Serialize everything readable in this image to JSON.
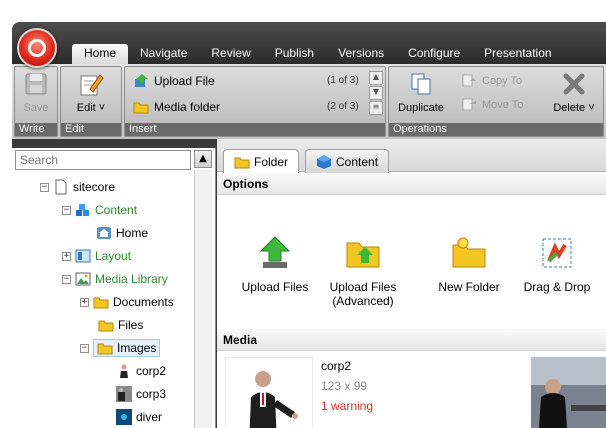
{
  "ribbon_tabs": [
    "Home",
    "Navigate",
    "Review",
    "Publish",
    "Versions",
    "Configure",
    "Presentation"
  ],
  "groups": {
    "write": {
      "label": "Write",
      "save": "Save"
    },
    "edit": {
      "label": "Edit",
      "edit": "Edit ˅"
    },
    "insert": {
      "label": "Insert",
      "items": [
        {
          "label": "Upload File",
          "count": "(1 of 3)"
        },
        {
          "label": "Media folder",
          "count": "(2 of 3)"
        }
      ]
    },
    "operations": {
      "label": "Operations",
      "duplicate": "Duplicate",
      "copy_to": "Copy To",
      "move_to": "Move To",
      "delete": "Delete ˅"
    }
  },
  "search": {
    "placeholder": "Search"
  },
  "tree": [
    {
      "label": "sitecore"
    },
    {
      "label": "Content"
    },
    {
      "label": "Home"
    },
    {
      "label": "Layout"
    },
    {
      "label": "Media Library"
    },
    {
      "label": "Documents"
    },
    {
      "label": "Files"
    },
    {
      "label": "Images"
    },
    {
      "label": "corp2"
    },
    {
      "label": "corp3"
    },
    {
      "label": "diver"
    }
  ],
  "content_tabs": [
    "Folder",
    "Content"
  ],
  "sections": {
    "options": "Options",
    "media": "Media"
  },
  "options": [
    {
      "label": "Upload Files",
      "sub": ""
    },
    {
      "label": "Upload Files",
      "sub": "(Advanced)"
    },
    {
      "label": "New Folder",
      "sub": ""
    },
    {
      "label": "Drag & Drop",
      "sub": ""
    }
  ],
  "media": [
    {
      "name": "corp2",
      "size": "123 x 99",
      "warning": "1 warning"
    }
  ]
}
